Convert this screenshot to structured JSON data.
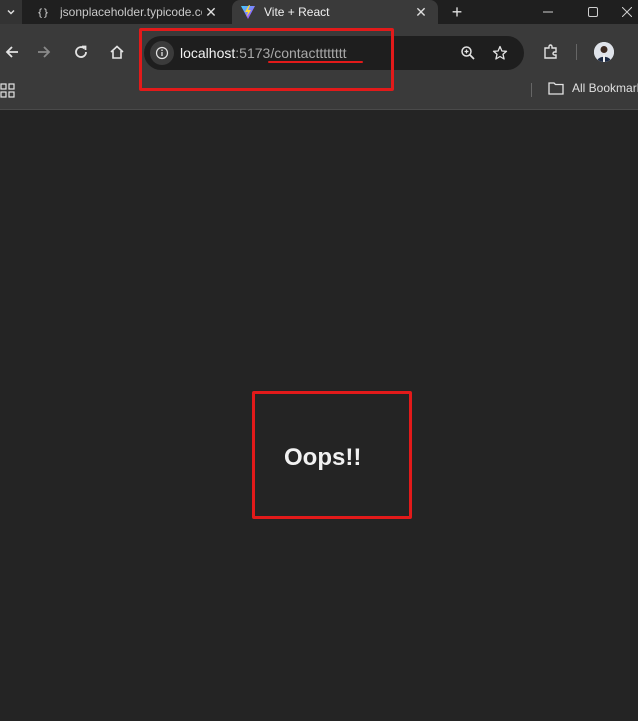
{
  "tabs": [
    {
      "title": "jsonplaceholder.typicode.com",
      "favicon": "jsonplaceholder-icon",
      "active": false
    },
    {
      "title": "Vite + React",
      "favicon": "vite-icon",
      "active": true
    }
  ],
  "toolbar": {
    "url_host": "localhost",
    "url_port": ":5173",
    "url_path": "/contactttttttt"
  },
  "bookmarks": {
    "all_bookmarks_label": "All Bookmarks"
  },
  "page": {
    "heading": "Oops!!"
  },
  "colors": {
    "page_background": "#242424",
    "annotation": "#e21a1a"
  }
}
